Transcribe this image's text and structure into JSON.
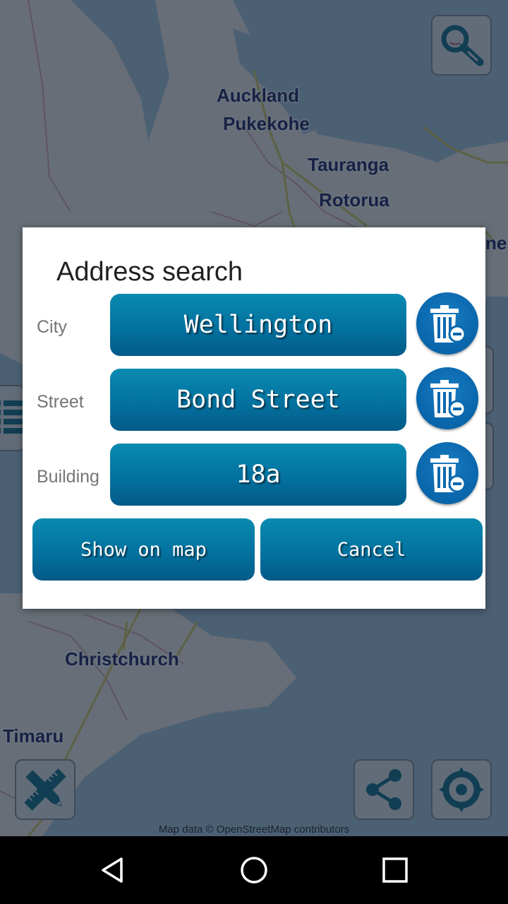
{
  "map": {
    "cities": [
      {
        "name": "Auckland"
      },
      {
        "name": "Pukekohe"
      },
      {
        "name": "Tauranga"
      },
      {
        "name": "Rotorua"
      },
      {
        "name": "ne"
      },
      {
        "name": "Christchurch"
      },
      {
        "name": "Timaru"
      }
    ],
    "attribution": "Map data © OpenStreetMap contributors",
    "buttons": {
      "search": {
        "icon": "search-icon"
      },
      "measure": {
        "icon": "ruler-pencil-icon"
      },
      "share": {
        "icon": "share-icon"
      },
      "locate": {
        "icon": "locate-icon"
      },
      "layers": {
        "icon": "list-icon"
      }
    }
  },
  "dialog": {
    "title": "Address search",
    "fields": [
      {
        "label": "City",
        "value": "Wellington",
        "clear_icon": "trash-icon"
      },
      {
        "label": "Street",
        "value": "Bond Street",
        "clear_icon": "trash-icon"
      },
      {
        "label": "Building",
        "value": "18a",
        "clear_icon": "trash-icon"
      }
    ],
    "show_on_map_label": "Show on map",
    "cancel_label": "Cancel"
  },
  "navbar": {
    "back": "back-icon",
    "home": "home-icon",
    "recents": "recents-icon"
  },
  "colors": {
    "button_blue": "#0372a0",
    "trash_blue": "#0a68ae",
    "icon_teal": "#0f6a80",
    "city_label": "#1e1e5a"
  }
}
